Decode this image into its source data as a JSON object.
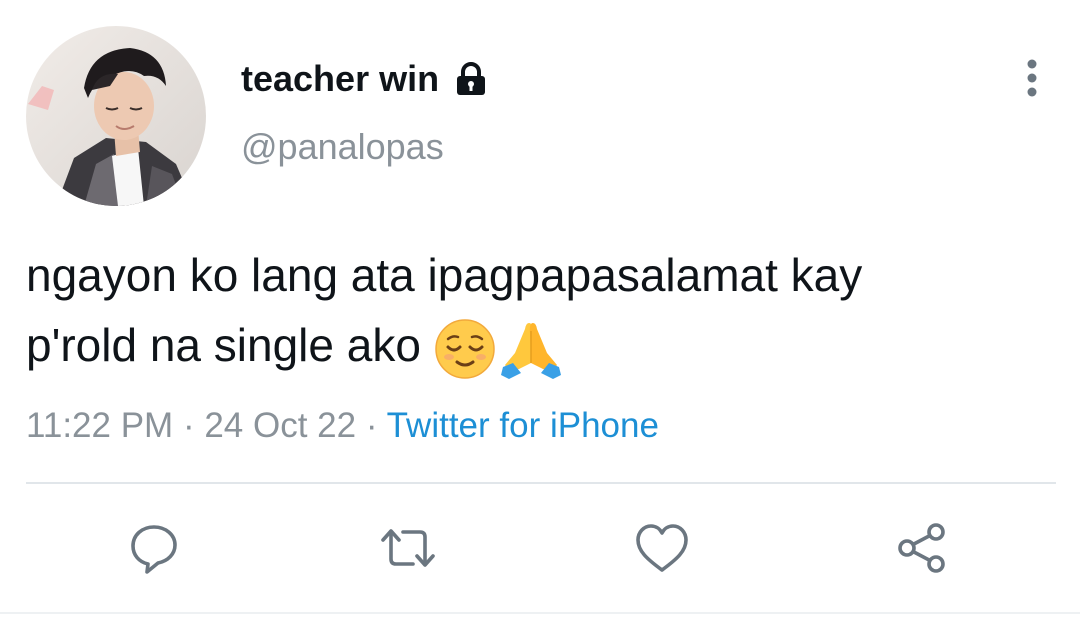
{
  "tweet": {
    "display_name": "teacher win",
    "handle": "@panalopas",
    "text_line1": "ngayon ko lang ata ipagpapasalamat kay",
    "text_line2": "p'rold na single ako",
    "emojis": [
      "relieved-face-emoji",
      "folded-hands-emoji"
    ],
    "time": "11:22 PM",
    "date": "24 Oct 22",
    "separator": "·",
    "source": "Twitter for iPhone",
    "protected": true
  },
  "icons": {
    "lock": "lock-icon",
    "more": "more-vertical-icon",
    "reply": "reply-icon",
    "retweet": "retweet-icon",
    "like": "heart-icon",
    "share": "share-icon"
  },
  "colors": {
    "text": "#0f1419",
    "secondary": "#8a9299",
    "link": "#1d8fd5",
    "divider": "#e1e6ea",
    "icon": "#6b7680"
  }
}
